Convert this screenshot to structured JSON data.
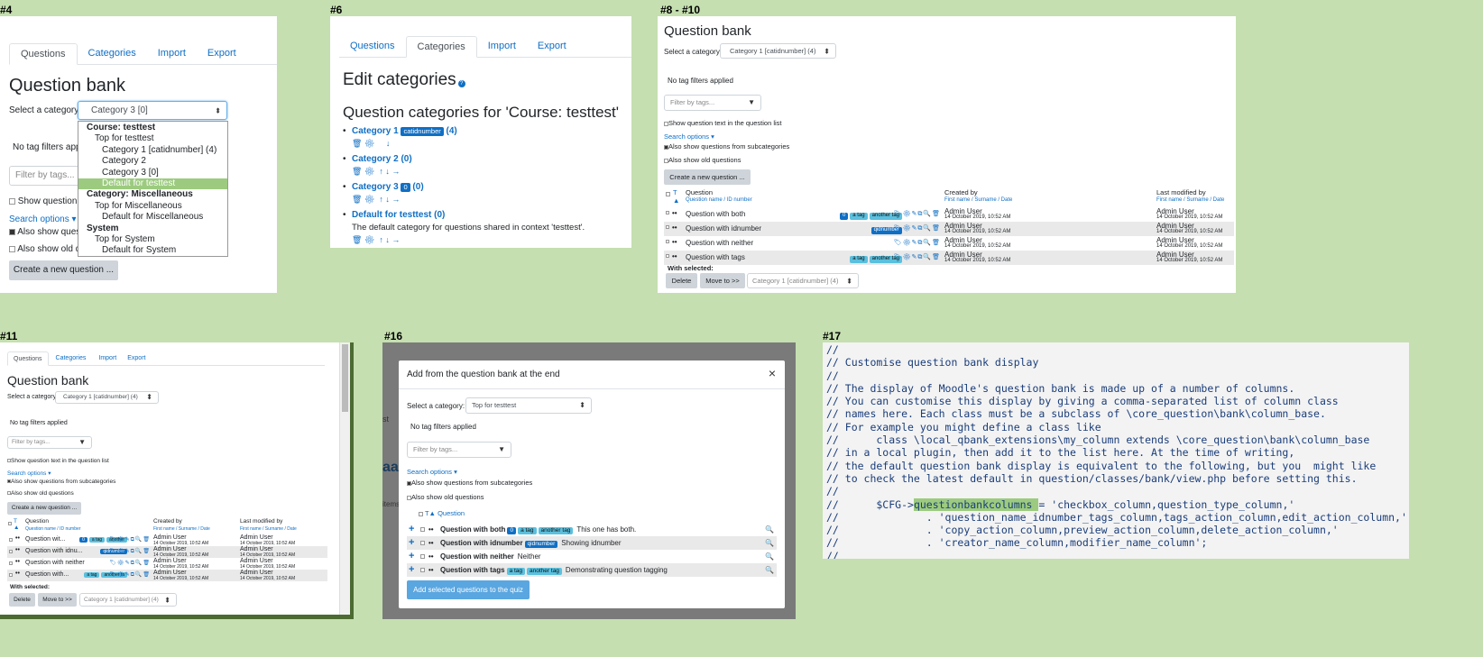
{
  "labels": {
    "p4": "#4",
    "p6": "#6",
    "p8": "#8 - #10",
    "p11": "#11",
    "p16": "#16",
    "p17": "#17"
  },
  "p4": {
    "tabs": [
      "Questions",
      "Categories",
      "Import",
      "Export"
    ],
    "title": "Question bank",
    "select_label": "Select a category:",
    "selected": "Category 3 [0]",
    "no_tag": "No tag filters app",
    "filter_placeholder": "Filter by tags...",
    "show_q": "Show question t",
    "search_opts": "Search options",
    "also_sub": "Also show quest",
    "also_old": "Also show old q",
    "create": "Create a new question ...",
    "dropdown": [
      {
        "text": "Course: testtest",
        "level": 0,
        "bold": true
      },
      {
        "text": "Top for testtest",
        "level": 1
      },
      {
        "text": "Category 1 [catidnumber] (4)",
        "level": 2
      },
      {
        "text": "Category 2",
        "level": 2
      },
      {
        "text": "Category 3 [0]",
        "level": 2
      },
      {
        "text": "Default for testtest",
        "level": 2,
        "selected": true
      },
      {
        "text": "Category: Miscellaneous",
        "level": 0,
        "bold": true
      },
      {
        "text": "Top for Miscellaneous",
        "level": 1
      },
      {
        "text": "Default for Miscellaneous",
        "level": 2
      },
      {
        "text": "System",
        "level": 0,
        "bold": true
      },
      {
        "text": "Top for System",
        "level": 1
      },
      {
        "text": "Default for System",
        "level": 2
      }
    ]
  },
  "p6": {
    "tabs": [
      "Questions",
      "Categories",
      "Import",
      "Export"
    ],
    "title": "Edit categories",
    "subtitle": "Question categories for 'Course: testtest'",
    "cats": [
      {
        "name": "Category 1",
        "badge": "catidnumber",
        "count": "(4)",
        "icons": "🗑 ⚙     ↓"
      },
      {
        "name": "Category 2 (0)",
        "badge": "",
        "count": "",
        "icons": "🗑 ⚙  ↑ ↓ →"
      },
      {
        "name": "Category 3",
        "badge": "0",
        "count": "(0)",
        "icons": "🗑 ⚙  ↑ ↓ →"
      },
      {
        "name": "Default for testtest (0)",
        "badge": "",
        "count": "",
        "desc": "The default category for questions shared in context 'testtest'.",
        "icons": "🗑 ⚙  ↑ ↓ →"
      }
    ]
  },
  "p8": {
    "title": "Question bank",
    "select_label": "Select a category:",
    "selected": "Category 1 [catidnumber] (4)",
    "no_tag": "No tag filters applied",
    "filter_placeholder": "Filter by tags...",
    "show_q": "Show question text in the question list",
    "search_opts": "Search options",
    "also_sub": "Also show questions from subcategories",
    "also_old": "Also show old questions",
    "create": "Create a new question ...",
    "col_t": "T",
    "col_question": "Question",
    "col_question_sub": "Question name / ID number",
    "col_created": "Created by",
    "col_created_sub": "First name / Surname / Date",
    "col_modified": "Last modified by",
    "col_modified_sub": "First name / Surname / Date",
    "rows": [
      {
        "name": "Question with both",
        "badges": [
          "0",
          "a tag",
          "another tag"
        ],
        "user": "Admin User",
        "date": "14 October 2019, 10:52 AM"
      },
      {
        "name": "Question with idnumber",
        "badges": [
          "qidnumber"
        ],
        "user": "Admin User",
        "date": "14 October 2019, 10:52 AM"
      },
      {
        "name": "Question with neither",
        "badges": [],
        "user": "Admin User",
        "date": "14 October 2019, 10:52 AM"
      },
      {
        "name": "Question with tags",
        "badges": [
          "a tag",
          "another tag"
        ],
        "user": "Admin User",
        "date": "14 October 2019, 10:52 AM"
      }
    ],
    "with_selected": "With selected:",
    "delete": "Delete",
    "move": "Move to >>",
    "move_target": "Category 1 [catidnumber] (4)"
  },
  "p11": {
    "tabs": [
      "Questions",
      "Categories",
      "Import",
      "Export"
    ],
    "title": "Question bank",
    "select_label": "Select a category:",
    "selected": "Category 1 [catidnumber] (4)",
    "no_tag": "No tag filters applied",
    "filter_placeholder": "Filter by tags...",
    "show_q": "Show question text in the question list",
    "search_opts": "Search options",
    "also_sub": "Also show questions from subcategories",
    "also_old": "Also show old questions",
    "create": "Create a new question ...",
    "col_t": "T",
    "col_question": "Question",
    "col_question_sub": "Question name / ID number",
    "col_created": "Created by",
    "col_created_sub": "First name / Surname / Date",
    "col_modified": "Last modified by",
    "col_modified_sub": "First name / Surname / Date",
    "rows": [
      {
        "name": "Question wit...",
        "badges": [
          "0",
          "a tag",
          "another"
        ],
        "user": "Admin User",
        "date": "14 October 2019, 10:52 AM"
      },
      {
        "name": "Question with idnu...",
        "badges": [
          "qidnumber"
        ],
        "user": "Admin User",
        "date": "14 October 2019, 10:52 AM"
      },
      {
        "name": "Question with neither",
        "badges": [],
        "user": "Admin User",
        "date": "14 October 2019, 10:52 AM"
      },
      {
        "name": "Question with...",
        "badges": [
          "a tag",
          "another ta"
        ],
        "user": "Admin User",
        "date": "14 October 2019, 10:52 AM"
      }
    ],
    "with_selected": "With selected:",
    "delete": "Delete",
    "move": "Move to >>",
    "move_target": "Category 1 [catidnumber] (4)"
  },
  "p16": {
    "modal_title": "Add from the question bank at the end",
    "close": "×",
    "select_label": "Select a category:",
    "selected": "Top for testtest",
    "no_tag": "No tag filters applied",
    "filter_placeholder": "Filter by tags...",
    "search_opts": "Search options",
    "also_sub": "Also show questions from subcategories",
    "also_old": "Also show old questions",
    "col_t": "T",
    "col_question": "Question",
    "bg_text1": "st",
    "bg_text2": "aa",
    "bg_text3": "items",
    "rows": [
      {
        "name": "Question with both",
        "badges": [
          "0",
          "a tag",
          "another tag"
        ],
        "text": "This one has both."
      },
      {
        "name": "Question with idnumber",
        "badges": [
          "qidnumber"
        ],
        "text": "Showing idnumber"
      },
      {
        "name": "Question with neither",
        "badges": [],
        "text": "Neither"
      },
      {
        "name": "Question with tags",
        "badges": [
          "a tag",
          "another tag"
        ],
        "text": "Demonstrating question tagging"
      }
    ],
    "add_btn": "Add selected questions to the quiz"
  },
  "p17": {
    "lines": [
      "//",
      "// Customise question bank display",
      "//",
      "// The display of Moodle's question bank is made up of a number of columns.",
      "// You can customise this display by giving a comma-separated list of column class",
      "// names here. Each class must be a subclass of \\core_question\\bank\\column_base.",
      "// For example you might define a class like",
      "//      class \\local_qbank_extensions\\my_column extends \\core_question\\bank\\column_base",
      "// in a local plugin, then add it to the list here. At the time of writing,",
      "// the default question bank display is equivalent to the following, but you  might like",
      "// to check the latest default in question/classes/bank/view.php before setting this.",
      "//"
    ],
    "cfg_pre": "//      $CFG->",
    "cfg_hl": "questionbankcolumns ",
    "cfg_post": "= 'checkbox_column,question_type_column,'",
    "lines2": [
      "//              . 'question_name_idnumber_tags_column,tags_action_column,edit_action_column,'",
      "//              . 'copy_action_column,preview_action_column,delete_action_column,'",
      "//              . 'creator_name_column,modifier_name_column';",
      "//"
    ]
  }
}
